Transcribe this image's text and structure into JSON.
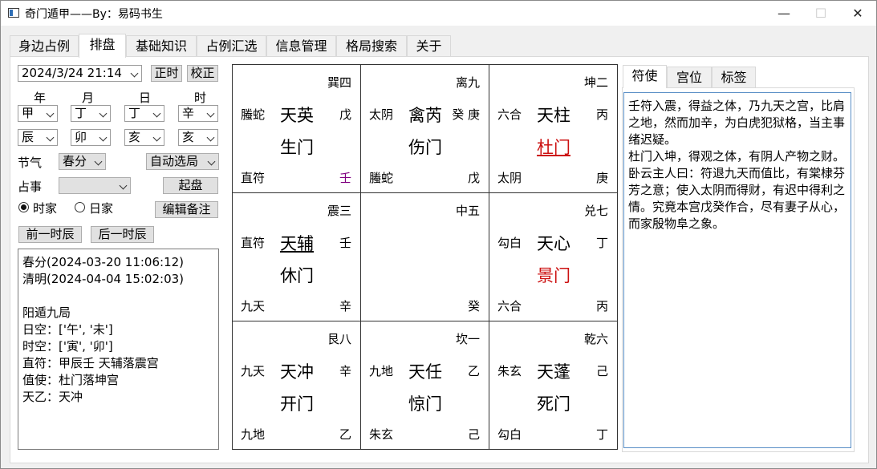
{
  "window": {
    "title": "奇门遁甲——By：易码书生",
    "minimize": "—",
    "maximize": "☐",
    "close": "✕"
  },
  "tabs": [
    "身边占例",
    "排盘",
    "基础知识",
    "占例汇选",
    "信息管理",
    "格局搜索",
    "关于"
  ],
  "active_tab": "排盘",
  "controls": {
    "datetime": "2024/3/24 21:14",
    "btn_now": "正时",
    "btn_calibrate": "校正",
    "pillar_headers": [
      "年",
      "月",
      "日",
      "时"
    ],
    "pillar_stems": [
      "甲",
      "丁",
      "丁",
      "辛"
    ],
    "pillar_branches": [
      "辰",
      "卯",
      "亥",
      "亥"
    ],
    "jieqi_label": "节气",
    "jieqi_value": "春分",
    "ju_select": "自动选局",
    "zhanshi_label": "占事",
    "zhanshi_value": "",
    "btn_qipan": "起盘",
    "radio_shijia": "时家",
    "radio_rijia": "日家",
    "btn_edit_note": "编辑备注",
    "btn_prev": "前一时辰",
    "btn_next": "后一时辰"
  },
  "info_lines": [
    "春分(2024-03-20 11:06:12)",
    "清明(2024-04-04 15:02:03)",
    "",
    "阳遁九局",
    "日空：['午', '未']",
    "时空：['寅', '卯']",
    "直符：甲辰壬 天辅落震宫",
    "值使：杜门落坤宫",
    "天乙：天冲"
  ],
  "palaces": [
    {
      "gua": "巽四",
      "god": "螣蛇",
      "star": "天英",
      "tgan": "戊",
      "door": "生门",
      "bl": "直符",
      "br": "壬",
      "door_color": "#000000",
      "br_color": "#800080"
    },
    {
      "gua": "离九",
      "god": "太阴",
      "star": "禽芮",
      "tgan": "癸 庚",
      "door": "伤门",
      "bl": "螣蛇",
      "br": "戊",
      "door_color": "#000000",
      "br_color": "#000000"
    },
    {
      "gua": "坤二",
      "god": "六合",
      "star": "天柱",
      "tgan": "丙",
      "door": "杜门",
      "bl": "太阴",
      "br": "庚",
      "door_color": "#cc1111",
      "br_color": "#000000"
    },
    {
      "gua": "震三",
      "god": "直符",
      "star": "天辅",
      "tgan": "壬",
      "door": "休门",
      "bl": "九天",
      "br": "辛",
      "door_color": "#000000",
      "br_color": "#000000"
    },
    {
      "gua": "中五",
      "god": "",
      "star": "",
      "tgan": "",
      "door": "",
      "bl": "",
      "br": "癸",
      "door_color": "#000000",
      "br_color": "#000000"
    },
    {
      "gua": "兑七",
      "god": "勾白",
      "star": "天心",
      "tgan": "丁",
      "door": "景门",
      "bl": "六合",
      "br": "丙",
      "door_color": "#cc1111",
      "br_color": "#000000"
    },
    {
      "gua": "艮八",
      "god": "九天",
      "star": "天冲",
      "tgan": "辛",
      "door": "开门",
      "bl": "九地",
      "br": "乙",
      "door_color": "#000000",
      "br_color": "#000000"
    },
    {
      "gua": "坎一",
      "god": "九地",
      "star": "天任",
      "tgan": "乙",
      "door": "惊门",
      "bl": "朱玄",
      "br": "己",
      "door_color": "#000000",
      "br_color": "#000000"
    },
    {
      "gua": "乾六",
      "god": "朱玄",
      "star": "天蓬",
      "tgan": "己",
      "door": "死门",
      "bl": "勾白",
      "br": "丁",
      "door_color": "#000000",
      "br_color": "#000000"
    }
  ],
  "right_tabs": [
    "符使",
    "宫位",
    "标签"
  ],
  "right_active": "符使",
  "right_paragraphs": [
    "壬符入震，得益之体，乃九天之宫，比肩之地，然而加辛，为白虎犯狱格，当主事绪迟疑。",
    "杜门入坤，得观之体，有阴人产物之财。",
    "卧云主人曰：符退九天而值比，有棠棣芬芳之意；使入太阴而得财，有迟中得利之情。究竟本宫戊癸作合，尽有妻子从心，而家殷物阜之象。"
  ]
}
